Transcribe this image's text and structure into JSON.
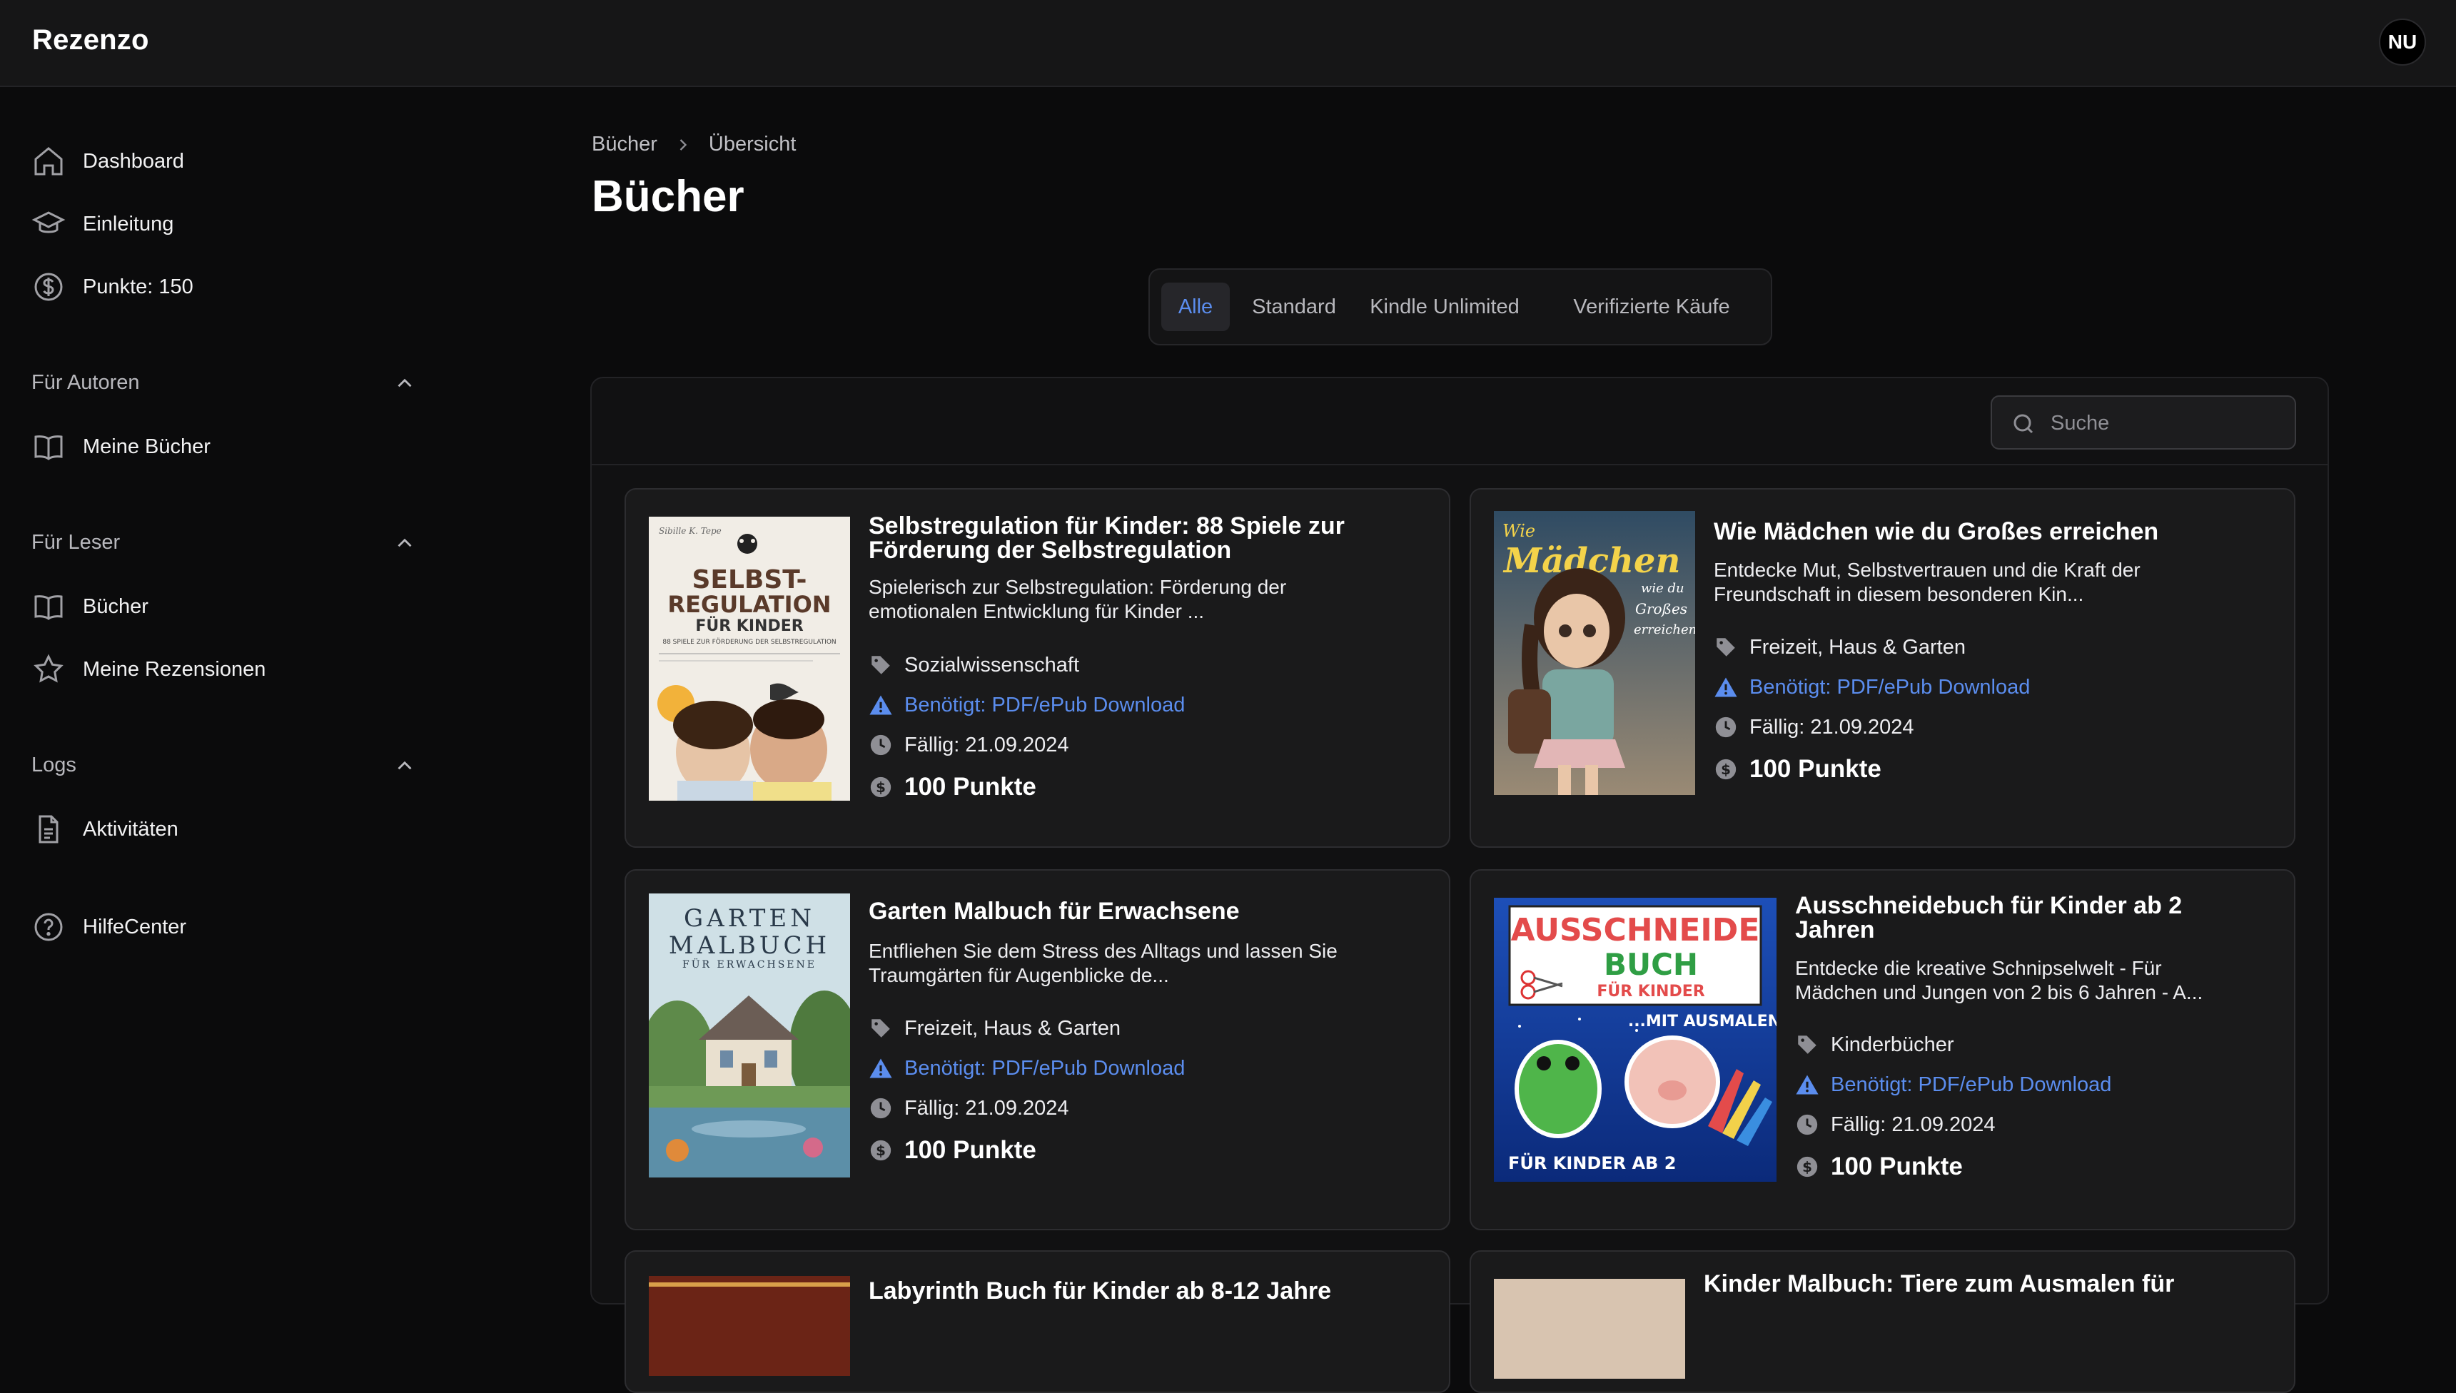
{
  "app": {
    "brand": "Rezenzo",
    "user_initials": "NU"
  },
  "sidebar": {
    "main": [
      {
        "label": "Dashboard",
        "icon": "home-icon"
      },
      {
        "label": "Einleitung",
        "icon": "graduation-cap-icon"
      },
      {
        "label": "Punkte: 150",
        "icon": "dollar-coin-icon"
      }
    ],
    "sections": [
      {
        "title": "Für Autoren",
        "items": [
          {
            "label": "Meine Bücher",
            "icon": "book-icon"
          }
        ]
      },
      {
        "title": "Für Leser",
        "items": [
          {
            "label": "Bücher",
            "icon": "book-icon"
          },
          {
            "label": "Meine Rezensionen",
            "icon": "star-icon"
          }
        ]
      },
      {
        "title": "Logs",
        "items": [
          {
            "label": "Aktivitäten",
            "icon": "document-icon"
          }
        ]
      }
    ],
    "help": {
      "label": "HilfeCenter",
      "icon": "help-circle-icon"
    }
  },
  "breadcrumb": {
    "parent": "Bücher",
    "current": "Übersicht"
  },
  "page": {
    "title": "Bücher"
  },
  "tabs": [
    {
      "label": "Alle",
      "active": true
    },
    {
      "label": "Standard",
      "active": false
    },
    {
      "label": "Kindle Unlimited",
      "active": false
    },
    {
      "label": "Verifizierte Käufe",
      "active": false
    }
  ],
  "search": {
    "placeholder": "Suche"
  },
  "books": [
    {
      "title_line1": "Selbstregulation für Kinder: 88 Spiele zur",
      "title_line2": "Förderung der Selbstregulation",
      "desc_line1": "Spielerisch zur Selbstregulation: Förderung der",
      "desc_line2": "emotionalen Entwicklung für Kinder ...",
      "category": "Sozialwissenschaft",
      "requirement": "Benötigt: PDF/ePub Download",
      "due": "Fällig: 21.09.2024",
      "points": "100 Punkte",
      "cover": {
        "line1": "SELBST-",
        "line2": "REGULATION",
        "line3": "FÜR KINDER",
        "line4": "88 SPIELE ZUR FÖRDERUNG DER SELBSTREGULATION"
      }
    },
    {
      "title_line1": "Wie Mädchen wie du Großes erreichen",
      "title_line2": "",
      "desc_line1": "Entdecke Mut, Selbstvertrauen und die Kraft der",
      "desc_line2": "Freundschaft in diesem besonderen Kin...",
      "category": "Freizeit, Haus & Garten",
      "requirement": "Benötigt: PDF/ePub Download",
      "due": "Fällig: 21.09.2024",
      "points": "100 Punkte",
      "cover": {
        "line1": "Wie",
        "line2": "Mädchen",
        "line3": "wie du",
        "line4": "Großes",
        "line5": "erreichen"
      }
    },
    {
      "title_line1": "Garten Malbuch für Erwachsene",
      "title_line2": "",
      "desc_line1": "Entfliehen Sie dem Stress des Alltags und lassen Sie",
      "desc_line2": "Traumgärten für Augenblicke de...",
      "category": "Freizeit, Haus & Garten",
      "requirement": "Benötigt: PDF/ePub Download",
      "due": "Fällig: 21.09.2024",
      "points": "100 Punkte",
      "cover": {
        "line1": "GARTEN",
        "line2": "MALBUCH",
        "line3": "FÜR ERWACHSENE"
      }
    },
    {
      "title_line1": "Ausschneidebuch für Kinder ab 2",
      "title_line2": "Jahren",
      "desc_line1": "Entdecke die kreative Schnipselwelt - Für",
      "desc_line2": "Mädchen und Jungen von 2 bis 6 Jahren - A...",
      "category": "Kinderbücher",
      "requirement": "Benötigt: PDF/ePub Download",
      "due": "Fällig: 21.09.2024",
      "points": "100 Punkte",
      "cover": {
        "line1": "AUSSCHNEIDE",
        "line2": "BUCH",
        "line3": "FÜR KINDER",
        "line4": "...MIT AUSMALEN!",
        "line5": "FÜR KINDER AB 2"
      }
    },
    {
      "title_line1": "Labyrinth Buch für Kinder ab 8-12 Jahre"
    },
    {
      "title_line1": "Kinder Malbuch: Tiere zum Ausmalen für"
    }
  ],
  "colors": {
    "accent": "#5b8dee",
    "background": "#0b0b0c",
    "card": "#1a1a1b"
  }
}
